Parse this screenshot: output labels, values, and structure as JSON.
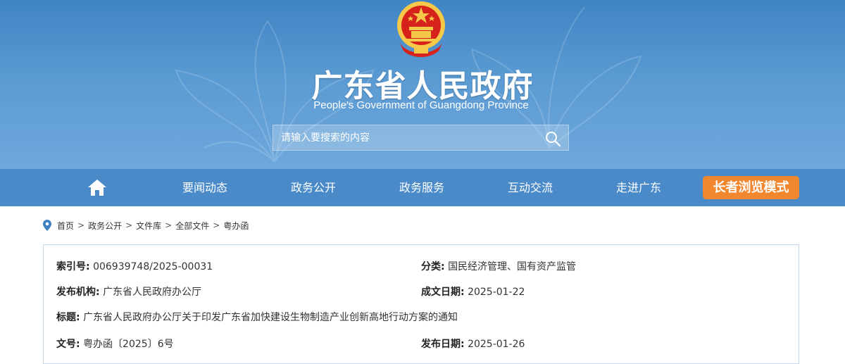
{
  "header": {
    "title": "广东省人民政府",
    "subtitle": "People's Government of Guangdong Province",
    "search_placeholder": "请输入要搜索的内容"
  },
  "nav": {
    "items": [
      "要闻动态",
      "政务公开",
      "政务服务",
      "互动交流",
      "走进广东"
    ],
    "elder_mode": "长者浏览模式"
  },
  "breadcrumb": [
    "首页",
    "政务公开",
    "文件库",
    "全部文件",
    "粤办函"
  ],
  "doc_info": {
    "index_label": "索引号:",
    "index_value": "006939748/2025-00031",
    "category_label": "分类:",
    "category_value": "国民经济管理、国有资产监管",
    "publisher_label": "发布机构:",
    "publisher_value": "广东省人民政府办公厅",
    "written_date_label": "成文日期:",
    "written_date_value": "2025-01-22",
    "title_label": "标题:",
    "title_value": "广东省人民政府办公厅关于印发广东省加快建设生物制造产业创新高地行动方案的通知",
    "doc_no_label": "文号:",
    "doc_no_value": "粤办函〔2025〕6号",
    "publish_date_label": "发布日期:",
    "publish_date_value": "2025-01-26"
  },
  "colors": {
    "banner": "#4a8ac9",
    "nav": "#4a8ac9",
    "elder_button": "#f1872f",
    "emblem_red": "#d7211b",
    "emblem_gold": "#f5c84a"
  },
  "icons": [
    "national-emblem-icon",
    "search-icon",
    "home-icon",
    "location-pin-icon"
  ]
}
